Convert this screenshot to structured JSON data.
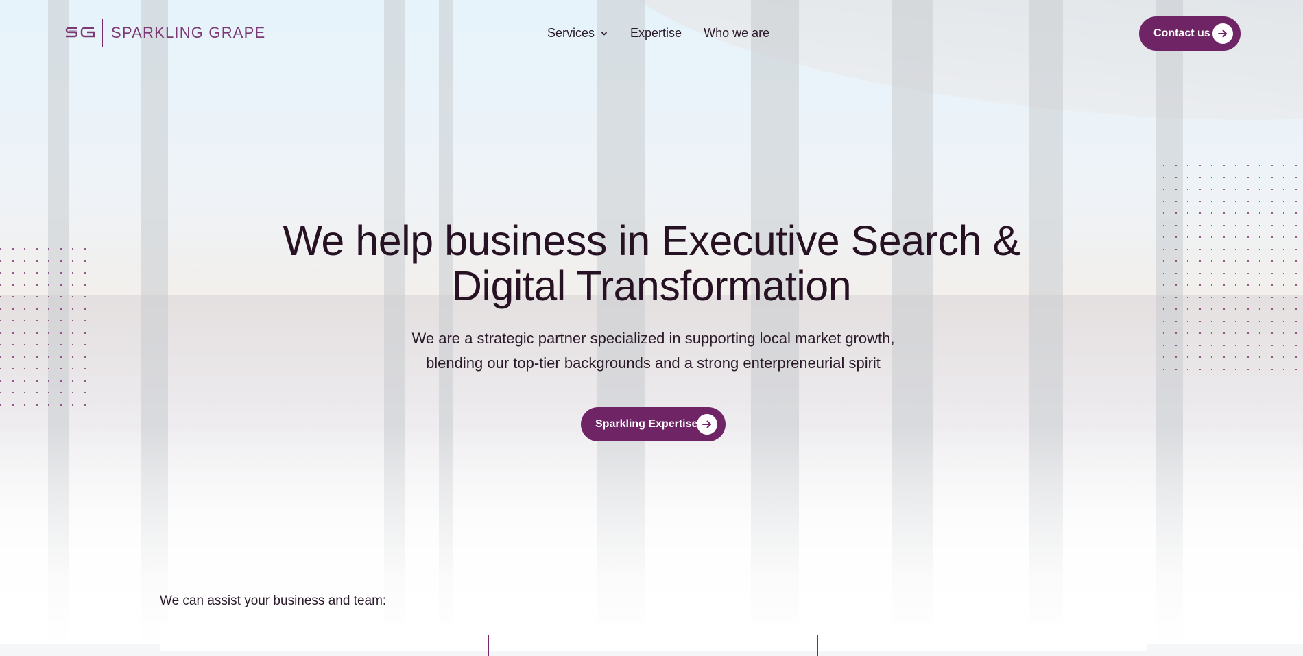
{
  "brand": {
    "mark": "SG",
    "name": "SPARKLING GRAPE",
    "color": "#7b3a74"
  },
  "nav": {
    "items": [
      {
        "label": "Services",
        "has_dropdown": true
      },
      {
        "label": "Expertise",
        "has_dropdown": false
      },
      {
        "label": "Who we are",
        "has_dropdown": false
      }
    ]
  },
  "header": {
    "contact_label": "Contact us"
  },
  "hero": {
    "title_line1": "We help business in Executive Search &",
    "title_line2": "Digital Transformation",
    "subtitle_line1": "We are a strategic partner specialized in supporting local market growth,",
    "subtitle_line2": "blending our top-tier backgrounds and a strong enterpreneurial spirit",
    "cta_label": "Sparkling Expertise"
  },
  "assist": {
    "heading": "We can assist your business and team:"
  },
  "colors": {
    "accent": "#6f2565",
    "text": "#271224"
  },
  "icons": {
    "chevron": "chevron-down-icon",
    "arrow": "arrow-right-icon"
  }
}
